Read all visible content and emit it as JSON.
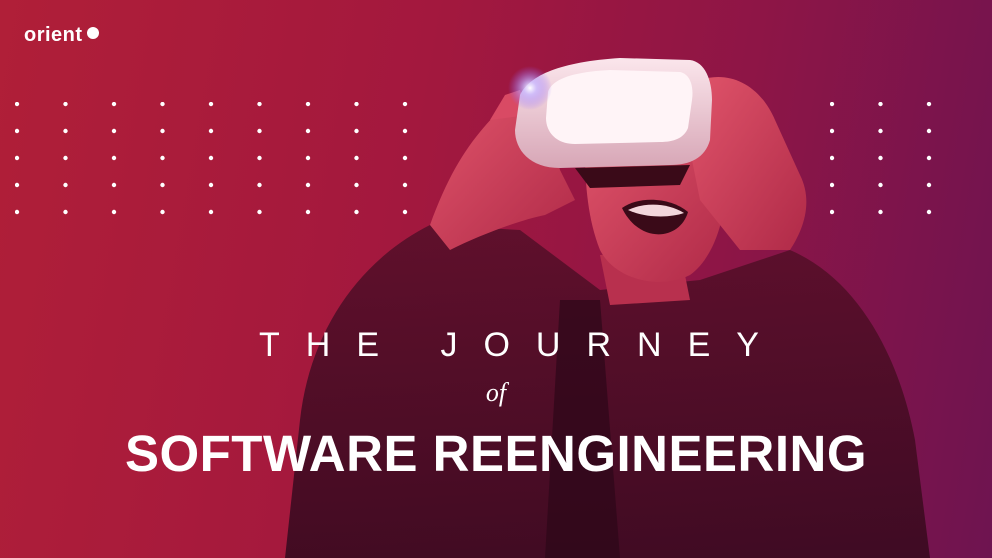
{
  "brand": {
    "name": "orient"
  },
  "headline": {
    "line1": "THE JOURNEY",
    "line2": "of",
    "line3": "SOFTWARE REENGINEERING"
  },
  "colors": {
    "background_start": "#b01f38",
    "background_end": "#6e1450",
    "text": "#ffffff"
  },
  "image": {
    "subject": "person-wearing-vr-headset"
  }
}
